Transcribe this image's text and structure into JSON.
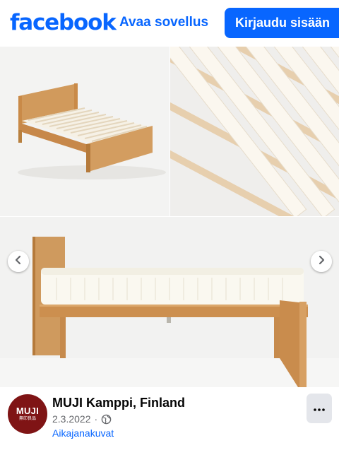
{
  "topbar": {
    "logo_text": "facebook",
    "open_app_label": "Avaa sovellus",
    "login_label": "Kirjaudu sisään"
  },
  "gallery": {
    "prev_icon": "chevron-left-icon",
    "next_icon": "chevron-right-icon"
  },
  "post": {
    "avatar": {
      "brand": "MUJI",
      "sub": "無印良品",
      "color": "#7f1415"
    },
    "page_name": "MUJI Kamppi, Finland",
    "date": "2.3.2022",
    "separator": "·",
    "audience_icon": "globe-icon",
    "album_link": "Aikajanakuvat",
    "more_icon": "ellipsis-icon"
  },
  "colors": {
    "brand_blue": "#0866ff",
    "secondary_text": "#65676b",
    "button_gray": "#e4e6eb"
  }
}
